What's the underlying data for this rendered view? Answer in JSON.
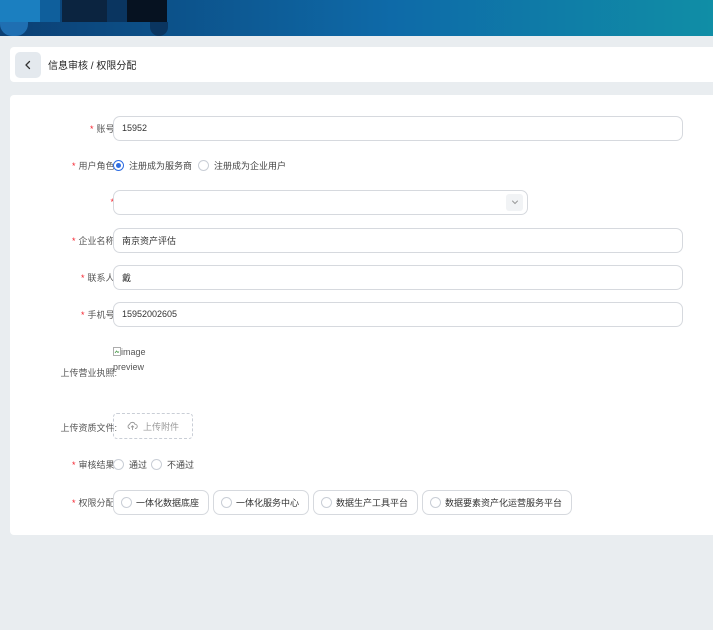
{
  "breadcrumb": "信息审核 / 权限分配",
  "form": {
    "account": {
      "label": "账号:",
      "value": "15952"
    },
    "user_role": {
      "label": "用户角色:",
      "options": [
        {
          "label": "注册成为服务商",
          "checked": true
        },
        {
          "label": "注册成为企业用户",
          "checked": false
        }
      ]
    },
    "select_field": {
      "value": ""
    },
    "company_name": {
      "label": "企业名称:",
      "value": "南京资产评估"
    },
    "contact": {
      "label": "联系人:",
      "value": "戴"
    },
    "phone": {
      "label": "手机号:",
      "value": "15952002605"
    },
    "business_license": {
      "label": "上传营业执照:",
      "preview_line1": "image",
      "preview_line2": "preview"
    },
    "qualification": {
      "label": "上传资质文件:",
      "upload_label": "上传附件"
    },
    "review_result": {
      "label": "审核结果:",
      "options": [
        {
          "label": "通过",
          "checked": false
        },
        {
          "label": "不通过",
          "checked": false
        }
      ]
    },
    "permissions": {
      "label": "权限分配:",
      "options": [
        {
          "label": "一体化数据底座"
        },
        {
          "label": "一体化服务中心"
        },
        {
          "label": "数据生产工具平台"
        },
        {
          "label": "数据要素资产化运营服务平台"
        }
      ]
    }
  },
  "colors": {
    "accent": "#2f6de1",
    "required": "#f5222d",
    "background": "#e9edf0"
  }
}
